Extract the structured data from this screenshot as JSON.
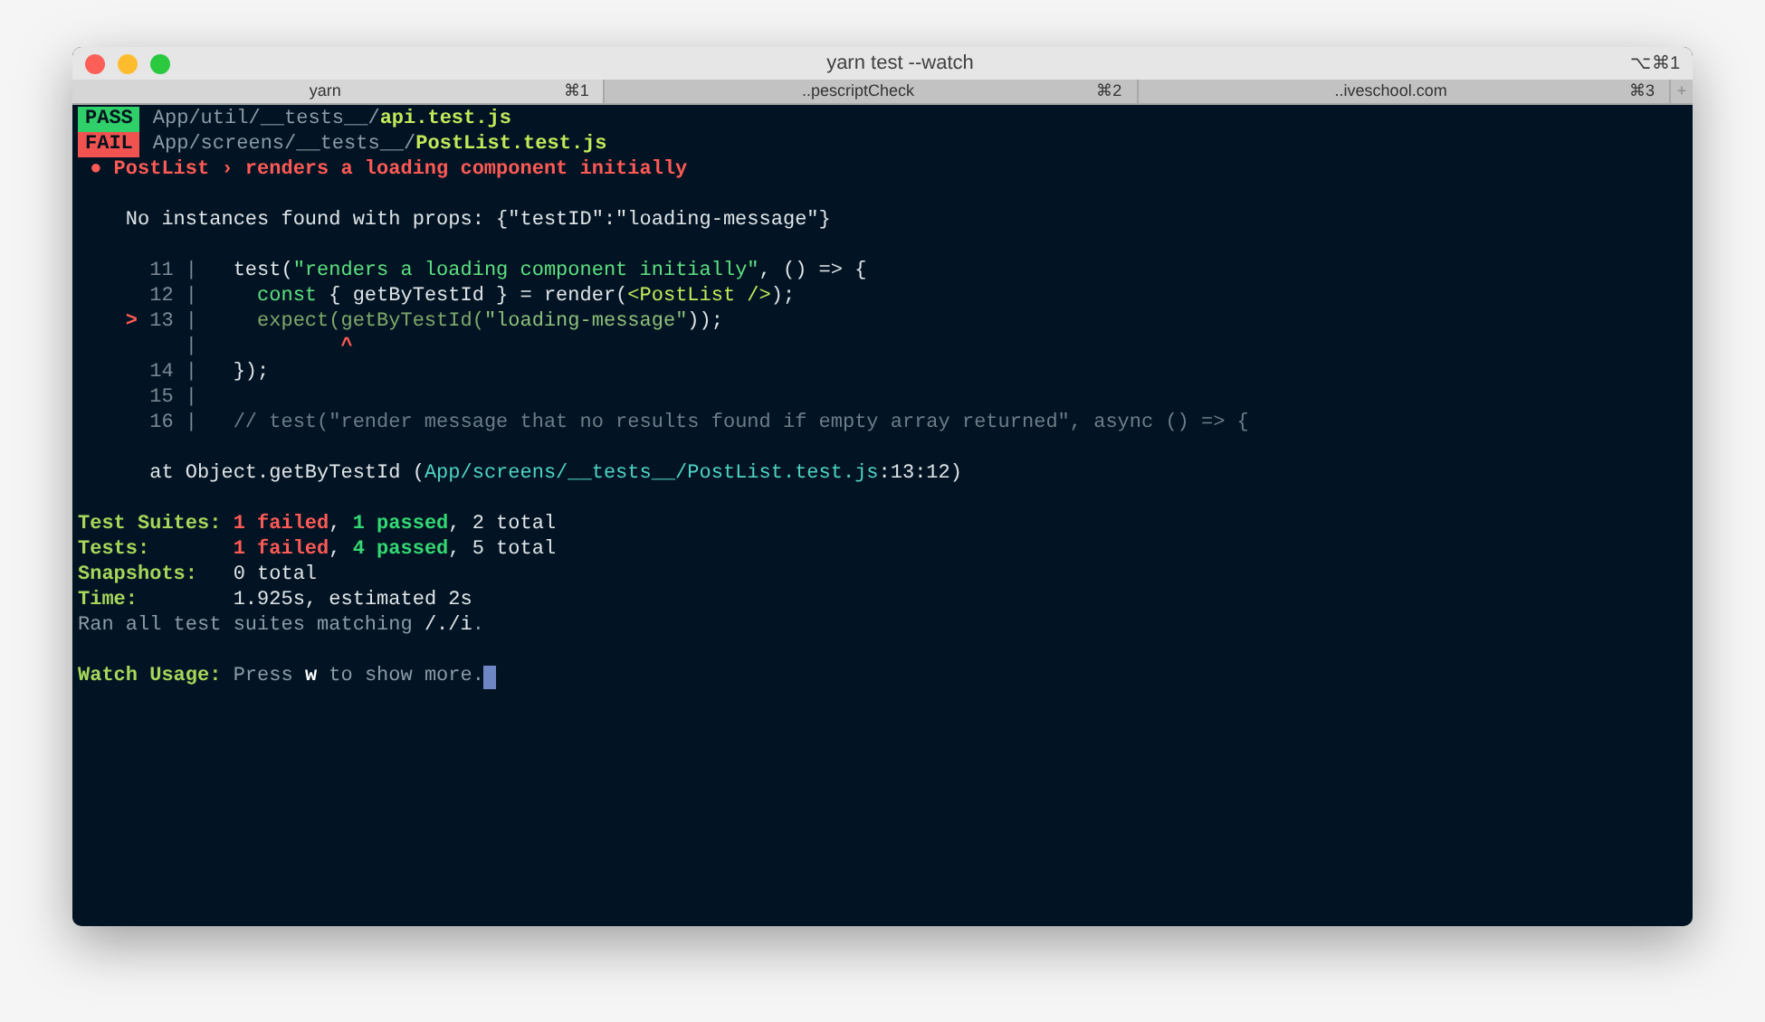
{
  "window": {
    "title": "yarn test --watch",
    "shortcut": "⌥⌘1"
  },
  "tabs": [
    {
      "label": "yarn",
      "shortcut": "⌘1",
      "selected": true
    },
    {
      "label": "..pescriptCheck",
      "shortcut": "⌘2",
      "selected": false
    },
    {
      "label": "..iveschool.com",
      "shortcut": "⌘3",
      "selected": false
    }
  ],
  "new_tab": "+",
  "terminal_lines": [
    {
      "kind": "text",
      "segments": [
        {
          "kind": "pass_badge",
          "text": "PASS"
        },
        {
          "kind": "path",
          "text": "App/util/__tests__/"
        },
        {
          "kind": "file",
          "text": "api.test.js"
        }
      ]
    },
    {
      "kind": "text",
      "segments": [
        {
          "kind": "fail_badge",
          "text": "FAIL"
        },
        {
          "kind": "path",
          "text": "App/screens/__tests__/"
        },
        {
          "kind": "file",
          "text": "PostList.test.js"
        }
      ]
    },
    {
      "kind": "text",
      "segments": [
        {
          "kind": "error",
          "text": " ● PostList › renders a loading component initially"
        }
      ]
    },
    {
      "kind": "blank"
    },
    {
      "kind": "text",
      "segments": [
        {
          "kind": "code",
          "text": "    No instances found with props: {\"testID\":\"loading-message\"}"
        }
      ]
    },
    {
      "kind": "blank"
    },
    {
      "kind": "text",
      "segments": [
        {
          "kind": "gutter",
          "text": "      11 |"
        },
        {
          "kind": "code",
          "text": "   test("
        },
        {
          "kind": "string",
          "text": "\"renders a loading component initially\""
        },
        {
          "kind": "code",
          "text": ", () => {"
        }
      ]
    },
    {
      "kind": "text",
      "segments": [
        {
          "kind": "gutter",
          "text": "      12 |"
        },
        {
          "kind": "keyword",
          "text": "     const"
        },
        {
          "kind": "code",
          "text": " { getByTestId } = render("
        },
        {
          "kind": "jsx",
          "text": "<PostList />"
        },
        {
          "kind": "code",
          "text": ");"
        }
      ]
    },
    {
      "kind": "text",
      "segments": [
        {
          "kind": "marker",
          "text": "    > "
        },
        {
          "kind": "gutter",
          "text": "13 |"
        },
        {
          "kind": "highlight",
          "text": "     expect(getByTestId("
        },
        {
          "kind": "highlight_string",
          "text": "\"loading-message\""
        },
        {
          "kind": "code",
          "text": "));"
        }
      ]
    },
    {
      "kind": "text",
      "segments": [
        {
          "kind": "gutter",
          "text": "         |"
        },
        {
          "kind": "marker",
          "text": "            ^"
        }
      ]
    },
    {
      "kind": "text",
      "segments": [
        {
          "kind": "gutter",
          "text": "      14 |"
        },
        {
          "kind": "code",
          "text": "   });"
        }
      ]
    },
    {
      "kind": "text",
      "segments": [
        {
          "kind": "gutter",
          "text": "      15 |"
        }
      ]
    },
    {
      "kind": "text",
      "segments": [
        {
          "kind": "gutter",
          "text": "      16 |"
        },
        {
          "kind": "comment",
          "text": "   // test(\"render message that no results found if empty array returned\", async () => {"
        }
      ]
    },
    {
      "kind": "blank"
    },
    {
      "kind": "text",
      "segments": [
        {
          "kind": "code",
          "text": "      at Object.getByTestId ("
        },
        {
          "kind": "link",
          "text": "App/screens/__tests__/PostList.test.js"
        },
        {
          "kind": "code",
          "text": ":13:12)"
        }
      ]
    },
    {
      "kind": "blank"
    },
    {
      "kind": "text",
      "segments": [
        {
          "kind": "label",
          "text": "Test Suites: "
        },
        {
          "kind": "failed",
          "text": "1 failed"
        },
        {
          "kind": "code",
          "text": ", "
        },
        {
          "kind": "passed",
          "text": "1 passed"
        },
        {
          "kind": "code",
          "text": ", 2 total"
        }
      ]
    },
    {
      "kind": "text",
      "segments": [
        {
          "kind": "label",
          "text": "Tests:       "
        },
        {
          "kind": "failed",
          "text": "1 failed"
        },
        {
          "kind": "code",
          "text": ", "
        },
        {
          "kind": "passed",
          "text": "4 passed"
        },
        {
          "kind": "code",
          "text": ", 5 total"
        }
      ]
    },
    {
      "kind": "text",
      "segments": [
        {
          "kind": "label",
          "text": "Snapshots:   "
        },
        {
          "kind": "code",
          "text": "0 total"
        }
      ]
    },
    {
      "kind": "text",
      "segments": [
        {
          "kind": "label",
          "text": "Time:        "
        },
        {
          "kind": "code",
          "text": "1.925s, estimated 2s"
        }
      ]
    },
    {
      "kind": "text",
      "segments": [
        {
          "kind": "dim",
          "text": "Ran all test suites matching "
        },
        {
          "kind": "code",
          "text": "/./i"
        },
        {
          "kind": "dim",
          "text": "."
        }
      ]
    },
    {
      "kind": "blank"
    },
    {
      "kind": "text",
      "cursor": true,
      "segments": [
        {
          "kind": "label",
          "text": "Watch Usage: "
        },
        {
          "kind": "dim",
          "text": "Press "
        },
        {
          "kind": "bold",
          "text": "w"
        },
        {
          "kind": "dim",
          "text": " to show more."
        }
      ]
    }
  ]
}
